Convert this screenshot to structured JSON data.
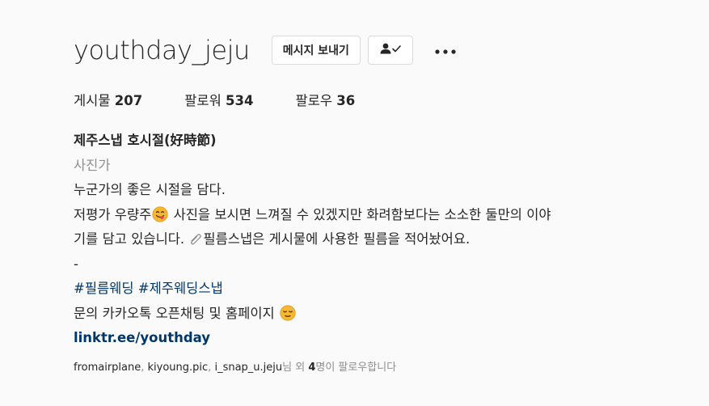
{
  "header": {
    "username": "youthday_jeju",
    "message_button_label": "메시지 보내기",
    "following_icon": "person-check-icon",
    "more_icon": "more-horizontal-icon"
  },
  "stats": {
    "posts_label": "게시물",
    "posts_count": "207",
    "followers_label": "팔로워",
    "followers_count": "534",
    "following_label": "팔로우",
    "following_count": "36"
  },
  "bio": {
    "full_name": "제주스냅 호시절(好時節)",
    "category": "사진가",
    "line1": "누군가의 좋은 시절을 담다.",
    "line2_part1": "저평가 우량주",
    "line2_emoji": "yum-face-emoji",
    "line2_part2": " 사진을 보시면 느껴질 수 있겠지만 화려함보다는 소소한 둘만의 이야",
    "line3_emoji": "paperclip-emoji",
    "line3_prefix": "기를 담고 있습니다. ",
    "line3_part2": "필름스냅은 게시물에 사용한 필름을 적어놨어요.",
    "separator": "-",
    "hashtags": [
      "#필름웨딩",
      "#제주웨딩스냅"
    ],
    "contact_text": "문의 카카오톡 오픈채팅 및 홈페이지 ",
    "contact_emoji": "relieved-face-emoji",
    "link": "linktr.ee/youthday"
  },
  "followed_by": {
    "accounts": [
      "fromairplane",
      "kiyoung.pic",
      "i_snap_u.jeju"
    ],
    "suffix_pre": "님 외 ",
    "count": "4",
    "suffix_post": "명이 팔로우합니다"
  },
  "colors": {
    "background": "#fafafa",
    "text": "#262626",
    "secondary": "#8e8e8e",
    "link": "#00376b",
    "border": "#dbdbdb"
  }
}
